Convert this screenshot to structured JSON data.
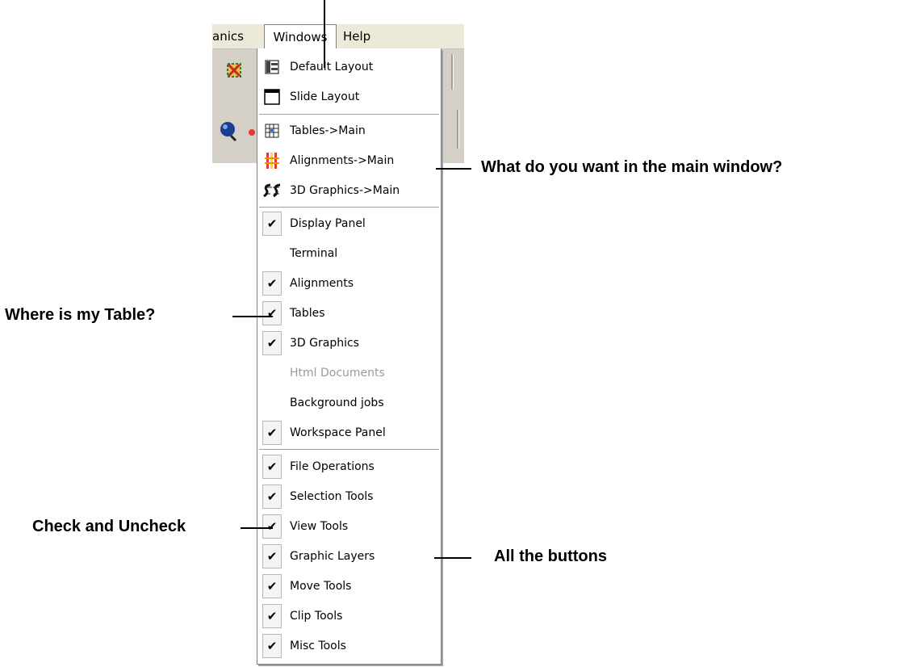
{
  "menubar": {
    "partial_menu": "anics",
    "windows": "Windows",
    "help": "Help"
  },
  "menu": {
    "layout_items": [
      {
        "label": "Default Layout",
        "icon": "default-layout-icon"
      },
      {
        "label": "Slide Layout",
        "icon": "slide-layout-icon"
      }
    ],
    "main_items": [
      {
        "label": "Tables->Main",
        "icon": "table-grid-icon"
      },
      {
        "label": "Alignments->Main",
        "icon": "alignments-icon"
      },
      {
        "label": "3D Graphics->Main",
        "icon": "3d-graphics-icon"
      }
    ],
    "panel_items": [
      {
        "label": "Display Panel",
        "checked": true,
        "enabled": true
      },
      {
        "label": "Terminal",
        "checked": false,
        "enabled": true
      },
      {
        "label": "Alignments",
        "checked": true,
        "enabled": true
      },
      {
        "label": "Tables",
        "checked": true,
        "enabled": true
      },
      {
        "label": "3D Graphics",
        "checked": true,
        "enabled": true
      },
      {
        "label": "Html Documents",
        "checked": false,
        "enabled": false
      },
      {
        "label": "Background jobs",
        "checked": false,
        "enabled": true
      },
      {
        "label": "Workspace Panel",
        "checked": true,
        "enabled": true
      }
    ],
    "toolbar_items": [
      {
        "label": "File Operations",
        "checked": true
      },
      {
        "label": "Selection Tools",
        "checked": true
      },
      {
        "label": "View Tools",
        "checked": true
      },
      {
        "label": "Graphic Layers",
        "checked": true
      },
      {
        "label": "Move Tools",
        "checked": true
      },
      {
        "label": "Clip Tools",
        "checked": true
      },
      {
        "label": "Misc Tools",
        "checked": true
      }
    ],
    "check_glyph": "✔"
  },
  "annotations": {
    "main_window": "What do you want in the main window?",
    "table": "Where is my Table?",
    "check": "Check and Uncheck",
    "buttons": "All the buttons"
  }
}
